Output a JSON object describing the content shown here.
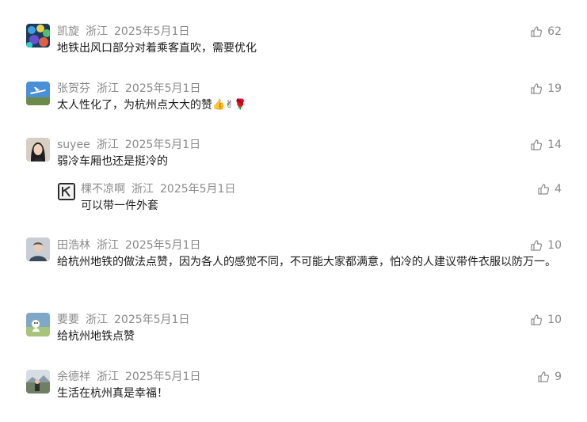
{
  "comments": [
    {
      "name": "凯旋",
      "location": "浙江",
      "date": "2025年5月1日",
      "text": "地铁出风口部分对着乘客直吹，需要优化",
      "likes": "62",
      "avatar": "marbles-avatar"
    },
    {
      "name": "张贺芬",
      "location": "浙江",
      "date": "2025年5月1日",
      "text": "太人性化了，为杭州点大大的赞",
      "emoji": [
        "👍",
        "✌",
        "🌹"
      ],
      "likes": "19",
      "avatar": "airplane-avatar"
    },
    {
      "name": "suyee",
      "location": "浙江",
      "date": "2025年5月1日",
      "text": "弱冷车厢也还是挺冷的",
      "likes": "14",
      "avatar": "portrait-avatar"
    },
    {
      "name": "棵不凉啊",
      "location": "浙江",
      "date": "2025年5月1日",
      "text": "可以带一件外套",
      "likes": "4",
      "avatar": "letter-avatar",
      "reply": true
    },
    {
      "name": "田浩林",
      "location": "浙江",
      "date": "2025年5月1日",
      "text": "给杭州地铁的做法点赞，因为各人的感觉不同，不可能大家都满意，怕冷的人建议带件衣服以防万一。",
      "likes": "10",
      "avatar": "man-avatar"
    },
    {
      "name": "要要",
      "location": "浙江",
      "date": "2025年5月1日",
      "text": "给杭州地铁点赞",
      "likes": "10",
      "avatar": "cartoon-avatar"
    },
    {
      "name": "余德祥",
      "location": "浙江",
      "date": "2025年5月1日",
      "text": "生活在杭州真是幸福！",
      "likes": "9",
      "avatar": "scenery-avatar"
    }
  ]
}
